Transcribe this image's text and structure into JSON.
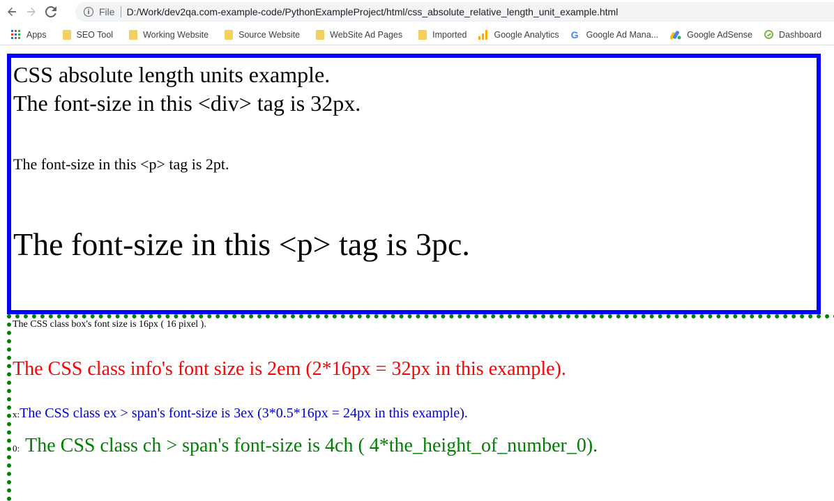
{
  "browser": {
    "file_label": "File",
    "url": "D:/Work/dev2qa.com-example-code/PythonExampleProject/html/css_absolute_relative_length_unit_example.html"
  },
  "bookmarks": [
    {
      "label": "Apps",
      "icon": "apps-icon"
    },
    {
      "label": "SEO Tool",
      "icon": "folder-icon"
    },
    {
      "label": "Working Website",
      "icon": "folder-icon"
    },
    {
      "label": "Source Website",
      "icon": "folder-icon"
    },
    {
      "label": "WebSite Ad Pages",
      "icon": "folder-icon"
    },
    {
      "label": "Imported",
      "icon": "folder-icon"
    },
    {
      "label": "Google Analytics",
      "icon": "analytics-icon"
    },
    {
      "label": "Google Ad Mana...",
      "icon": "google-icon"
    },
    {
      "label": "Google AdSense",
      "icon": "adsense-icon"
    },
    {
      "label": "Dashboard",
      "icon": "dashboard-icon"
    }
  ],
  "box": {
    "line1": "CSS absolute length units example.",
    "line2": "The font-size in this <div> tag is 32px.",
    "p_2pt": "The font-size in this <p> tag is 2pt.",
    "p_3pc": "The font-size in this <p> tag is 3pc."
  },
  "dotted": {
    "t16": "The CSS class box's font size is 16px ( 16 pixel ).",
    "info": "The CSS class info's font size is 2em (2*16px = 32px in this example).",
    "ex_prefix": "x:",
    "ex": "The CSS class ex > span's font-size is 3ex (3*0.5*16px = 24px in this example).",
    "ch_prefix": "0:",
    "ch": "The CSS class ch > span's font-size is 4ch ( 4*the_height_of_number_0)."
  },
  "colors": {
    "box_border": "#0000ff",
    "dotted_border": "#008000",
    "info_text": "#ff0000",
    "ex_text": "#0000cc",
    "ch_text": "#008000"
  }
}
